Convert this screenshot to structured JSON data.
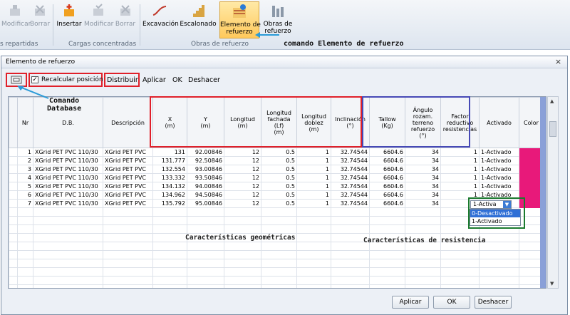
{
  "ribbon": {
    "buttons": [
      {
        "id": "modificar1",
        "label": "Modificar",
        "disabled": true
      },
      {
        "id": "borrar1",
        "label": "Borrar",
        "disabled": true
      },
      {
        "id": "insertar",
        "label": "Insertar",
        "disabled": false
      },
      {
        "id": "modificar2",
        "label": "Modificar",
        "disabled": true
      },
      {
        "id": "borrar2",
        "label": "Borrar",
        "disabled": true
      },
      {
        "id": "excavacion",
        "label": "Excavación",
        "disabled": false
      },
      {
        "id": "escalonado",
        "label": "Escalonado",
        "disabled": false
      },
      {
        "id": "elemento",
        "label_line1": "Elemento de",
        "label_line2": "refuerzo",
        "disabled": false,
        "selected": true
      },
      {
        "id": "obras",
        "label_line1": "Obras de",
        "label_line2": "refuerzo",
        "disabled": false
      }
    ],
    "groups": [
      "s repartidas",
      "Cargas concentradas",
      "Obras de refuerzo"
    ]
  },
  "annotations": {
    "comando_elemento": "comando Elemento de refuerzo",
    "comando_database_line1": "Comando",
    "comando_database_line2": "Database",
    "caract_geom": "Características geométricas",
    "caract_res": "Características de resistencia"
  },
  "window": {
    "title": "Elemento de refuerzo",
    "toolbar": {
      "recalcular": "Recalcular posición",
      "distribuir": "Distribuir",
      "aplicar": "Aplicar",
      "ok": "OK",
      "deshacer": "Deshacer"
    },
    "columns": [
      {
        "key": "nr",
        "label": "Nr"
      },
      {
        "key": "db",
        "label": "D.B."
      },
      {
        "key": "desc",
        "label": "Descripción"
      },
      {
        "key": "x",
        "label": "X\n(m)"
      },
      {
        "key": "y",
        "label": "Y\n(m)"
      },
      {
        "key": "longitud",
        "label": "Longitud\n(m)"
      },
      {
        "key": "lf",
        "label": "Longitud\nfachada\n(Lf)\n(m)"
      },
      {
        "key": "ld",
        "label": "Longitud\ndoblez\n(m)"
      },
      {
        "key": "inc",
        "label": "Inclinación\n(°)"
      },
      {
        "key": "tallow",
        "label": "Tallow\n(Kg)"
      },
      {
        "key": "ang",
        "label": "Ángulo\nrozam.\nterreno\nrefuerzo\n(°)"
      },
      {
        "key": "factor",
        "label": "Factor\nreductivo\nresistencias"
      },
      {
        "key": "act",
        "label": "Activado"
      },
      {
        "key": "color",
        "label": "Color"
      }
    ],
    "rows": [
      {
        "nr": "1",
        "db": "XGrid PET PVC 110/30",
        "desc": "XGrid PET PVC",
        "x": "131",
        "y": "92.00846",
        "longitud": "12",
        "lf": "0.5",
        "ld": "1",
        "inc": "32.74544",
        "tallow": "6604.6",
        "ang": "34",
        "factor": "1",
        "act": "1-Activado"
      },
      {
        "nr": "2",
        "db": "XGrid PET PVC 110/30",
        "desc": "XGrid PET PVC",
        "x": "131.777",
        "y": "92.50846",
        "longitud": "12",
        "lf": "0.5",
        "ld": "1",
        "inc": "32.74544",
        "tallow": "6604.6",
        "ang": "34",
        "factor": "1",
        "act": "1-Activado"
      },
      {
        "nr": "3",
        "db": "XGrid PET PVC 110/30",
        "desc": "XGrid PET PVC",
        "x": "132.554",
        "y": "93.00846",
        "longitud": "12",
        "lf": "0.5",
        "ld": "1",
        "inc": "32.74544",
        "tallow": "6604.6",
        "ang": "34",
        "factor": "1",
        "act": "1-Activado"
      },
      {
        "nr": "4",
        "db": "XGrid PET PVC 110/30",
        "desc": "XGrid PET PVC",
        "x": "133.332",
        "y": "93.50846",
        "longitud": "12",
        "lf": "0.5",
        "ld": "1",
        "inc": "32.74544",
        "tallow": "6604.6",
        "ang": "34",
        "factor": "1",
        "act": "1-Activado"
      },
      {
        "nr": "5",
        "db": "XGrid PET PVC 110/30",
        "desc": "XGrid PET PVC",
        "x": "134.132",
        "y": "94.00846",
        "longitud": "12",
        "lf": "0.5",
        "ld": "1",
        "inc": "32.74544",
        "tallow": "6604.6",
        "ang": "34",
        "factor": "1",
        "act": "1-Activado"
      },
      {
        "nr": "6",
        "db": "XGrid PET PVC 110/30",
        "desc": "XGrid PET PVC",
        "x": "134.962",
        "y": "94.50846",
        "longitud": "12",
        "lf": "0.5",
        "ld": "1",
        "inc": "32.74544",
        "tallow": "6604.6",
        "ang": "34",
        "factor": "1",
        "act": "1-Activado"
      },
      {
        "nr": "7",
        "db": "XGrid PET PVC 110/30",
        "desc": "XGrid PET PVC",
        "x": "135.792",
        "y": "95.00846",
        "longitud": "12",
        "lf": "0.5",
        "ld": "1",
        "inc": "32.74544",
        "tallow": "6604.6",
        "ang": "34",
        "factor": "1",
        "act": ""
      }
    ],
    "dropdown": {
      "value": "1-Activa",
      "options": [
        "0-Desactivado",
        "1-Activado"
      ]
    },
    "footer": {
      "aplicar": "Aplicar",
      "ok": "OK",
      "deshacer": "Deshacer"
    },
    "colors": {
      "color_cell": "#e8197a",
      "red_box": "#e0202a",
      "blue_box": "#4649b6",
      "green_box": "#1b7a2e"
    }
  }
}
